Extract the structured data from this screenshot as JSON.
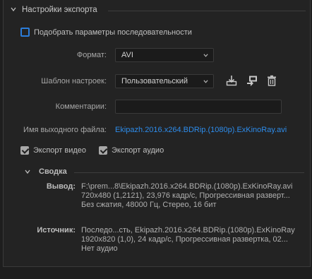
{
  "section": {
    "title": "Настройки экспорта"
  },
  "match_sequence": {
    "label": "Подобрать параметры последовательности",
    "checked": false
  },
  "format": {
    "label": "Формат:",
    "value": "AVI"
  },
  "preset": {
    "label": "Шаблон настроек:",
    "value": "Пользовательский"
  },
  "comments": {
    "label": "Комментарии:",
    "value": ""
  },
  "output": {
    "label": "Имя выходного файла:",
    "value": "Ekipazh.2016.x264.BDRip.(1080p).ExKinoRay.avi"
  },
  "export_video": {
    "label": "Экспорт видео",
    "checked": true
  },
  "export_audio": {
    "label": "Экспорт аудио",
    "checked": true
  },
  "summary": {
    "title": "Сводка",
    "output_label": "Вывод:",
    "output_lines": [
      "F:\\prem...8\\Ekipazh.2016.x264.BDRip.(1080p).ExKinoRay.avi",
      "720x480 (1,2121), 23,976 кадр/с, Прогрессивная разверт...",
      "Без сжатия, 48000 Гц, Стерео, 16 бит"
    ],
    "source_label": "Источник:",
    "source_lines": [
      "Последо...сть, Ekipazh.2016.x264.BDRip.(1080p).ExKinoRay",
      "1920x820 (1,0), 24 кадр/с, Прогрессивная развертка, 02...",
      "Нет аудио"
    ]
  },
  "colors": {
    "accent": "#2d8ceb",
    "checkbox_focus": "#2b7ddb",
    "background": "#232323"
  },
  "icons": [
    "chevron-down-icon",
    "save-preset-icon",
    "import-preset-icon",
    "delete-preset-icon"
  ]
}
